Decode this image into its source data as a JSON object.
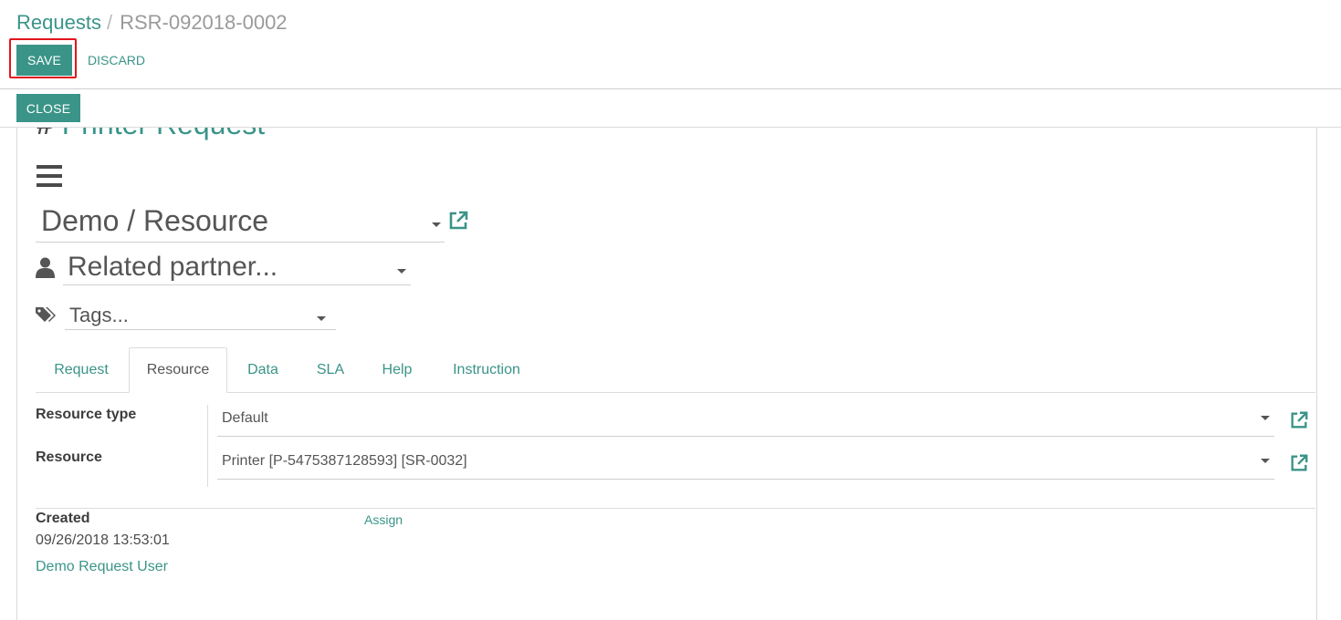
{
  "breadcrumb": {
    "parent": "Requests",
    "separator": "/",
    "current": "RSR-092018-0002"
  },
  "buttons": {
    "save": "SAVE",
    "discard": "DISCARD",
    "close": "CLOSE"
  },
  "form": {
    "hash": "#",
    "title": "Printer Request",
    "type_value": "Demo / Resource",
    "partner_placeholder": "Related partner...",
    "tags_placeholder": "Tags..."
  },
  "tabs": [
    "Request",
    "Resource",
    "Data",
    "SLA",
    "Help",
    "Instruction"
  ],
  "active_tab": "Resource",
  "resource_tab": {
    "resource_type_label": "Resource type",
    "resource_type_value": "Default",
    "resource_label": "Resource",
    "resource_value": "Printer [P-5475387128593] [SR-0032]"
  },
  "footer": {
    "created_label": "Created",
    "created_value": "09/26/2018 13:53:01",
    "assign_label": "Assign",
    "user": "Demo Request User"
  },
  "colors": {
    "accent": "#3a9488",
    "highlight": "#e3141b"
  },
  "icons": [
    "menu-icon",
    "external-link-icon",
    "user-icon",
    "tags-icon",
    "caret-down-icon"
  ]
}
